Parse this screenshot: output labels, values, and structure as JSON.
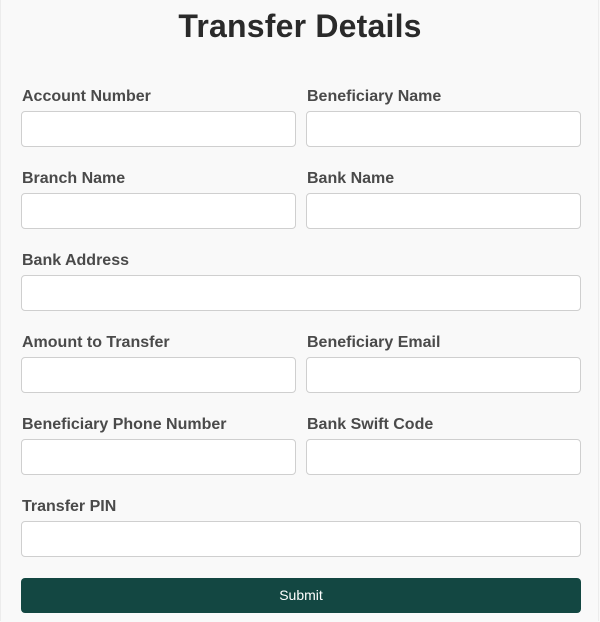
{
  "form": {
    "title": "Transfer Details",
    "fields": {
      "account_number": {
        "label": "Account Number",
        "value": "",
        "placeholder": ""
      },
      "beneficiary_name": {
        "label": "Beneficiary Name",
        "value": "",
        "placeholder": ""
      },
      "branch_name": {
        "label": "Branch Name",
        "value": "",
        "placeholder": ""
      },
      "bank_name": {
        "label": "Bank Name",
        "value": "",
        "placeholder": ""
      },
      "bank_address": {
        "label": "Bank Address",
        "value": "",
        "placeholder": ""
      },
      "amount_to_transfer": {
        "label": "Amount to Transfer",
        "value": "",
        "placeholder": ""
      },
      "beneficiary_email": {
        "label": "Beneficiary Email",
        "value": "",
        "placeholder": ""
      },
      "beneficiary_phone_number": {
        "label": "Beneficiary Phone Number",
        "value": "",
        "placeholder": ""
      },
      "bank_swift_code": {
        "label": "Bank Swift Code",
        "value": "",
        "placeholder": ""
      },
      "transfer_pin": {
        "label": "Transfer PIN",
        "value": "",
        "placeholder": ""
      }
    },
    "submit_label": "Submit",
    "colors": {
      "submit_background": "#134742",
      "submit_text": "#ffffff",
      "page_background": "#f9f9f9"
    }
  }
}
